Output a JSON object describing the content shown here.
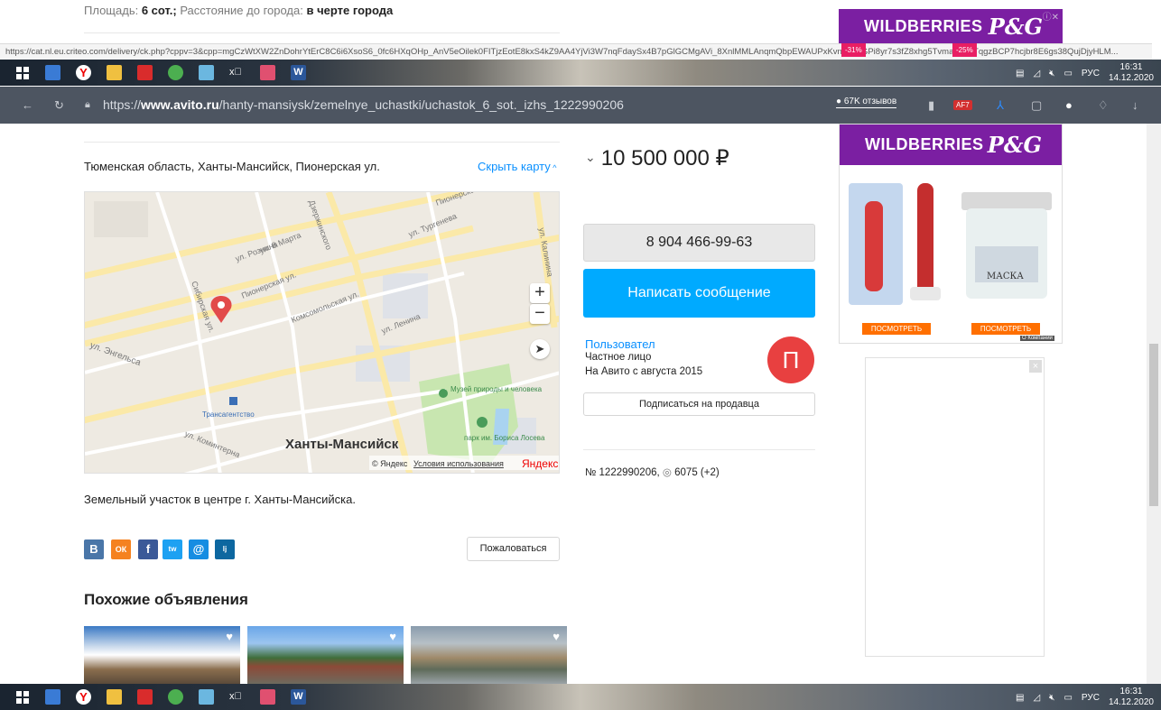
{
  "fragment": {
    "area_label": "Площадь:",
    "area_value": "6 сот.;",
    "distance_label": "Расстояние до города:",
    "distance_value": "в черте города"
  },
  "ads": {
    "brand1": "WILDBERRIES",
    "brand2": "P&G",
    "discount1": "-31%",
    "discount2": "-25%",
    "look_button": "ПОСМОТРЕТЬ",
    "about_company": "О Компании",
    "product2_name": "МАСКА",
    "close_glyph": "×"
  },
  "status_bar_url": "https://cat.nl.eu.criteo.com/delivery/ck.php?cppv=3&cpp=mgCzWtXW2ZnDohrYtErC8C6i6XsoS6_0fc6HXqOHp_AnV5eOilek0FITjzEotE8kxS4kZ9AA4YjVi3W7nqFdaySx4B7pGlGCMgAVi_8XnlMMLAnqmQbpEWAUPxKvnFofGGPi8yr7s3fZ8xhg5Tvmat8BleTqgzBCP7hcjbr8E6gs38QujDjyHLM...",
  "taskbar": {
    "lang": "РУС",
    "time": "16:31",
    "date": "14.12.2020"
  },
  "browser": {
    "url_prefix": "https://",
    "url_domain": "www.avito.ru",
    "url_path": "/hanty-mansiysk/zemelnye_uchastki/uchastok_6_sot._izhs_1222990206",
    "reviews": "67K отзывов",
    "ext_badge": "AF7"
  },
  "listing": {
    "address": "Тюменская область, Ханты-Мансийск, Пионерская ул.",
    "hide_map": "Скрыть карту",
    "description": "Земельный участок в центре г. Ханты-Мансийска.",
    "complain": "Пожаловаться",
    "similar_title": "Похожие объявления",
    "price": "10 500 000 ₽",
    "phone": "8 904 466-99-63",
    "message": "Написать сообщение",
    "seller_name": "Пользовател",
    "seller_type": "Частное лицо",
    "seller_since": "На Авито с августа 2015",
    "avatar_letter": "П",
    "subscribe": "Подписаться на продавца",
    "ad_number": "№ 1222990206,",
    "views": "6075 (+2)"
  },
  "map": {
    "city": "Ханты-Мансийск",
    "streets": [
      "ул. Рознина",
      "ул. 8 Марта",
      "Пионерская ул.",
      "Комсомольская ул.",
      "ул. Энгельса",
      "ул. Ленина",
      "ул. Тургенева",
      "ул. Калинина",
      "ул. Коминтерна",
      "Дзержинского",
      "Сибирская ул.",
      "Пионерская ул."
    ],
    "poi_museum": "Музей природы и человека",
    "poi_park": "парк им. Бориса Лосева",
    "poi_station": "Трансагентство",
    "copyright": "© Яндекс",
    "terms": "Условия использования",
    "logo": "Яндекс",
    "zoom_in": "+",
    "zoom_out": "−"
  },
  "share": [
    "В",
    "ОК",
    "f",
    "tw",
    "@",
    "lj"
  ]
}
